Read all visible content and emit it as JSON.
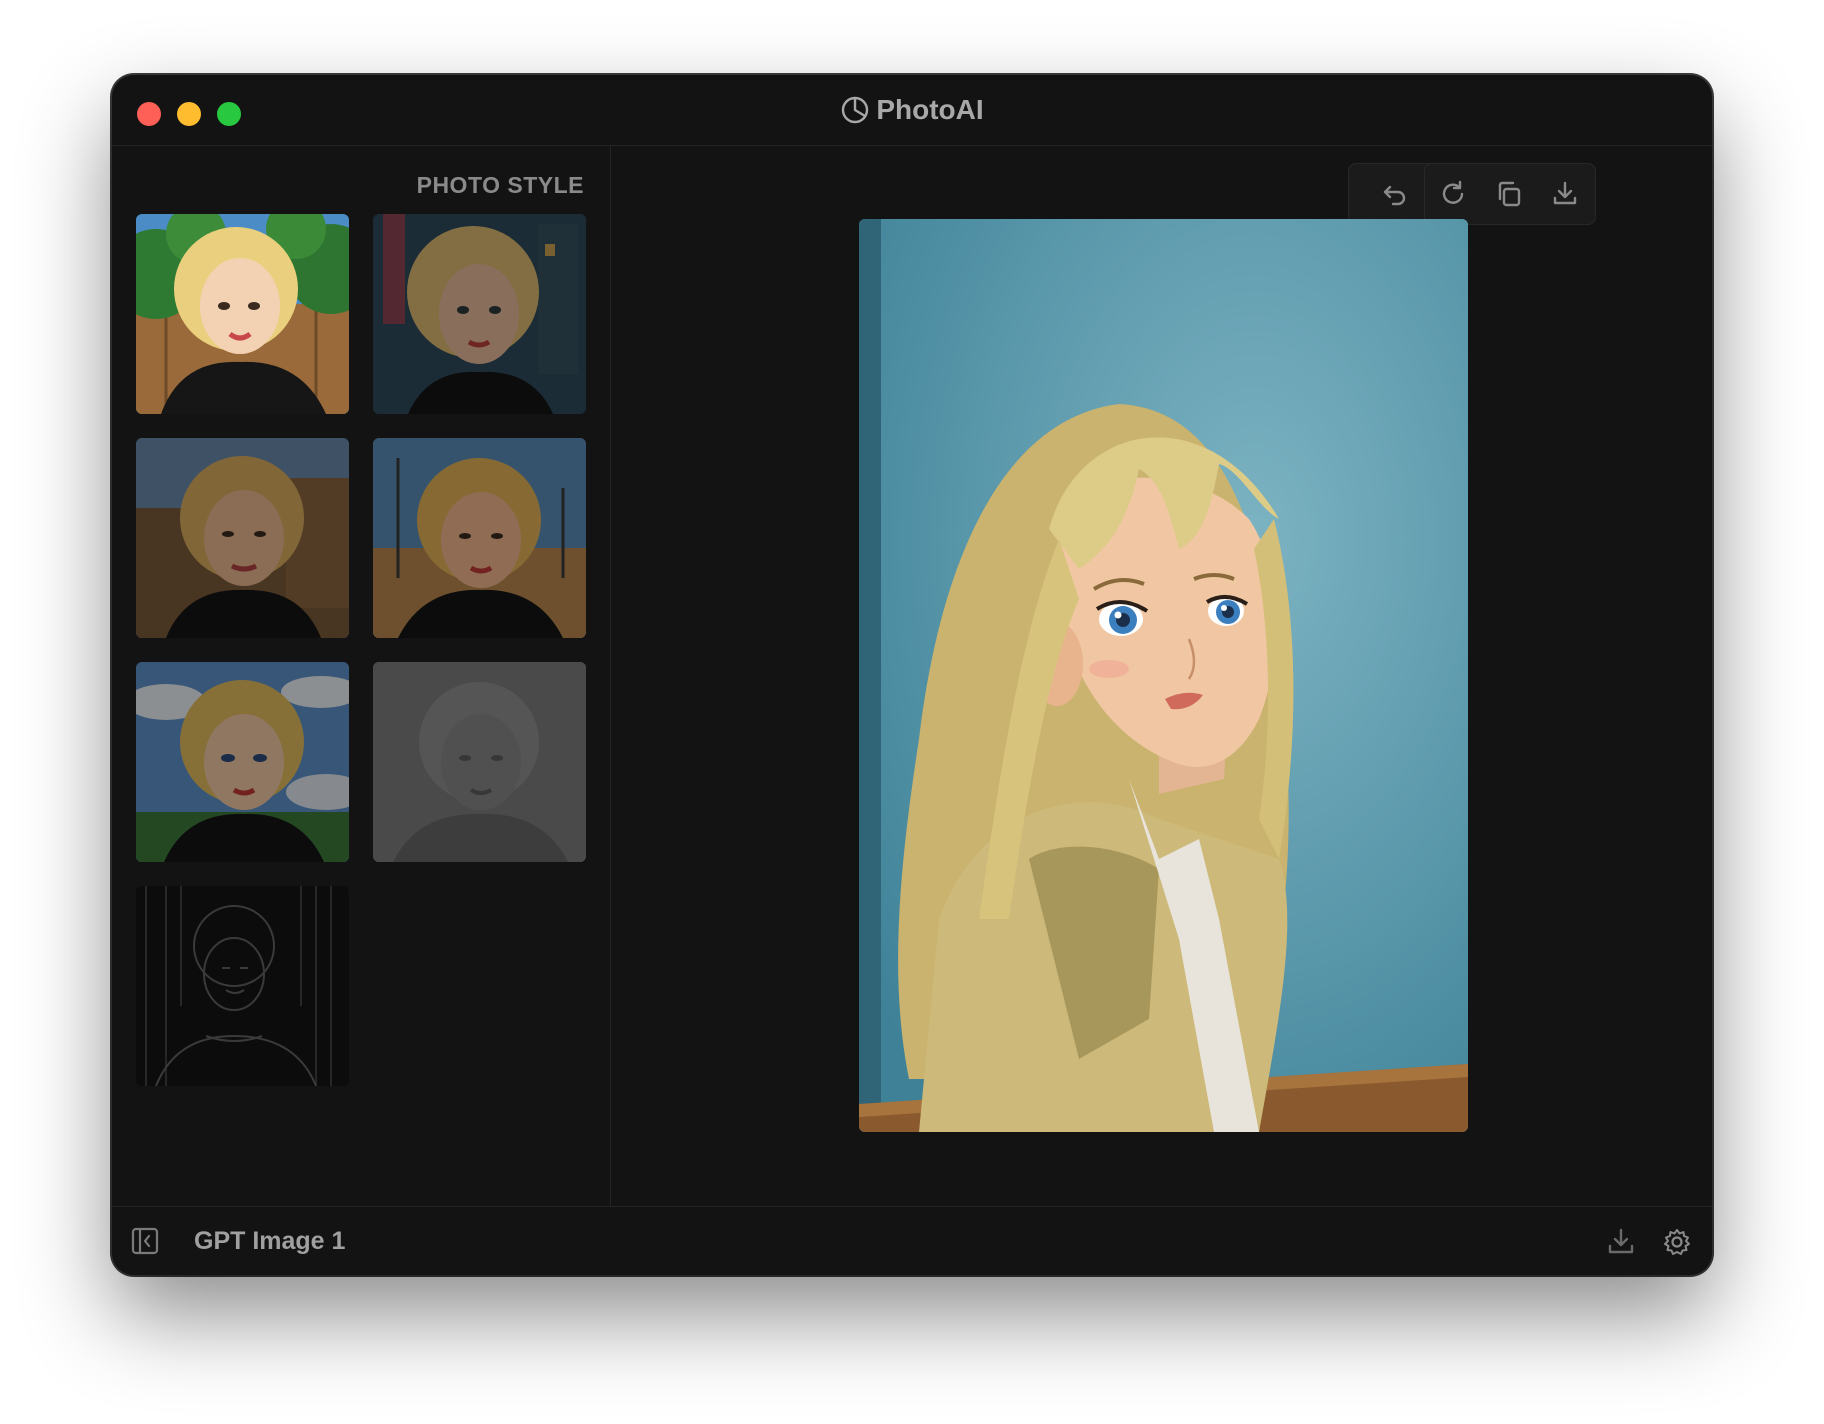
{
  "window": {
    "title": "PhotoAI",
    "title_icon": "aperture-icon",
    "traffic_lights": {
      "close": "#fe5f57",
      "minimize": "#febc2e",
      "zoom": "#28c840"
    }
  },
  "sidebar": {
    "heading": "PHOTO STYLE",
    "styles": [
      {
        "name": "illustrated-garden",
        "selected": false
      },
      {
        "name": "anime-city-night",
        "selected": false
      },
      {
        "name": "painted-cartoon",
        "selected": false
      },
      {
        "name": "anime-street",
        "selected": false
      },
      {
        "name": "cartoon-sky",
        "selected": false
      },
      {
        "name": "grayscale-photo",
        "selected": false
      },
      {
        "name": "line-art-sketch",
        "selected": false
      }
    ]
  },
  "toolbar": {
    "undo_icon": "undo-icon",
    "regenerate_icon": "refresh-icon",
    "copy_icon": "copy-icon",
    "download_icon": "download-icon"
  },
  "preview": {
    "subject": "anime-style portrait of blonde girl against blue wall"
  },
  "footer": {
    "model_name": "GPT Image 1",
    "toggle_sidebar_icon": "sidebar-toggle-icon",
    "save_icon": "save-icon",
    "settings_icon": "gear-icon"
  },
  "colors": {
    "window_bg": "#131313",
    "text_muted": "#8a8a8a",
    "preview_bg": "#4e93a6"
  }
}
